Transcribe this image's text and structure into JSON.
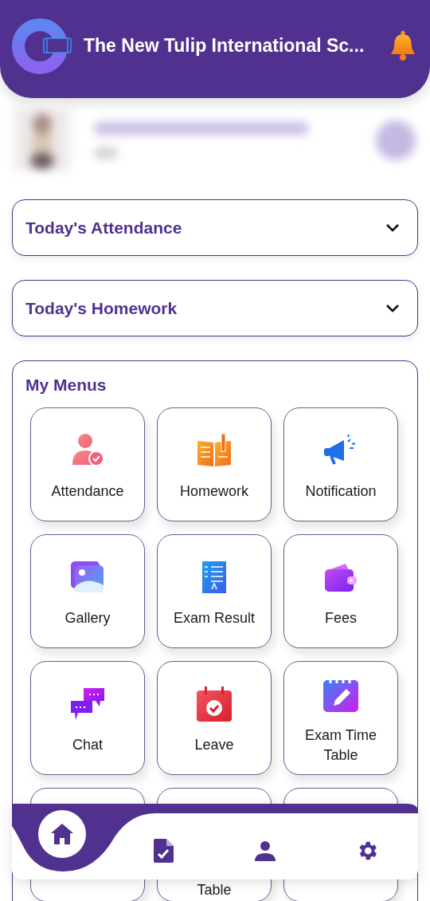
{
  "header": {
    "title": "The New Tulip International Sc..."
  },
  "accordions": [
    {
      "title": "Today's Attendance",
      "expanded": false
    },
    {
      "title": "Today's Homework",
      "expanded": false
    }
  ],
  "menus": {
    "title": "My Menus",
    "items": [
      {
        "kind": "attendance",
        "label": "Attendance"
      },
      {
        "kind": "homework",
        "label": "Homework"
      },
      {
        "kind": "notification",
        "label": "Notification"
      },
      {
        "kind": "gallery",
        "label": "Gallery"
      },
      {
        "kind": "result",
        "label": "Exam Result"
      },
      {
        "kind": "fees",
        "label": "Fees"
      },
      {
        "kind": "chat",
        "label": "Chat"
      },
      {
        "kind": "leave",
        "label": "Leave"
      },
      {
        "kind": "timetable",
        "label": "Exam Time Table"
      },
      {
        "kind": "blank"
      },
      {
        "kind": "blank",
        "label": "Table"
      },
      {
        "kind": "blank"
      }
    ]
  },
  "bottom_nav": {
    "items": [
      {
        "kind": "home",
        "selected": true
      },
      {
        "kind": "document",
        "selected": false
      },
      {
        "kind": "profile",
        "selected": false
      },
      {
        "kind": "settings",
        "selected": false
      }
    ]
  }
}
